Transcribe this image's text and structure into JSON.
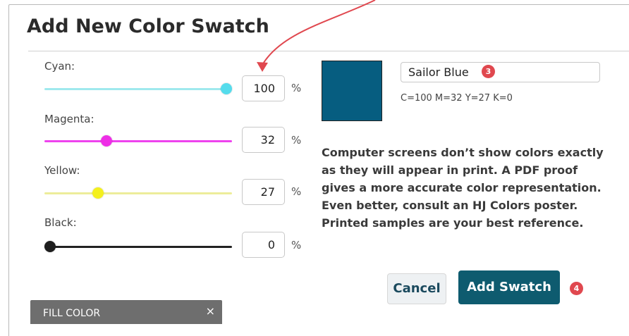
{
  "dialog": {
    "title": "Add New Color Swatch"
  },
  "channels": [
    {
      "label": "Cyan:",
      "value": "100",
      "unit": "%",
      "percent": 100,
      "track_color": "#9fe9ee",
      "thumb_color": "#55dcec"
    },
    {
      "label": "Magenta:",
      "value": "32",
      "unit": "%",
      "percent": 32,
      "track_color": "#ee43ee",
      "thumb_color": "#ee2ee6"
    },
    {
      "label": "Yellow:",
      "value": "27",
      "unit": "%",
      "percent": 27,
      "track_color": "#eded9a",
      "thumb_color": "#f4f01e"
    },
    {
      "label": "Black:",
      "value": "0",
      "unit": "%",
      "percent": 0,
      "track_color": "#222222",
      "thumb_color": "#1e1e1e"
    }
  ],
  "swatch": {
    "color": "#065d80",
    "name_value": "Sailor Blue",
    "cmyk_readout": "C=100 M=32 Y=27 K=0"
  },
  "notice": "Computer screens don’t show colors exactly as they will appear in print. A PDF proof gives a more accurate color representation. Even better, consult an HJ Colors poster. Printed samples are your best reference.",
  "buttons": {
    "cancel_label": "Cancel",
    "add_label": "Add Swatch"
  },
  "badges": {
    "name_step": "3",
    "add_step": "4",
    "color": "#e0484f"
  },
  "fill_panel": {
    "title": "FILL COLOR",
    "close_glyph": "×"
  },
  "annotation": {
    "arrow_color": "#e0484f"
  }
}
